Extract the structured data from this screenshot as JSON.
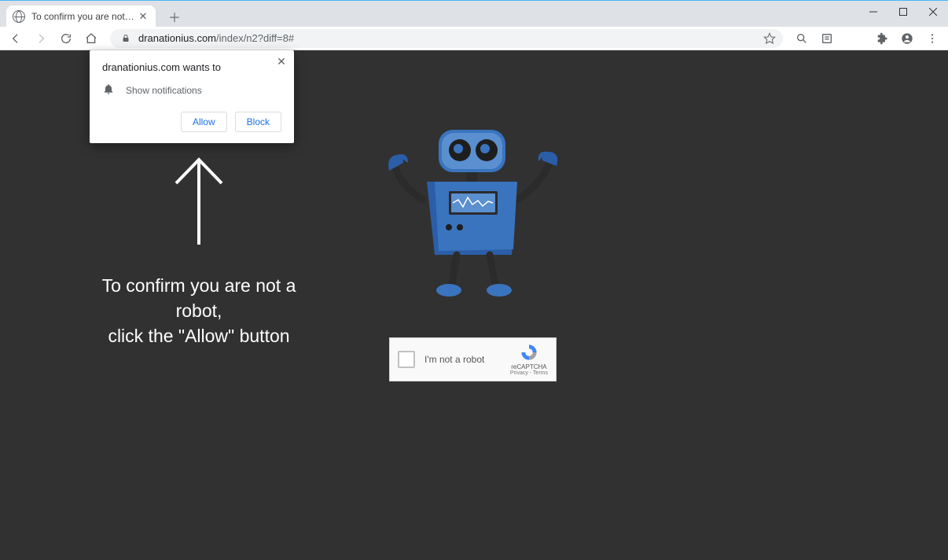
{
  "window": {
    "minimize": "–",
    "maximize": "☐",
    "close": "✕"
  },
  "tab": {
    "title": "To confirm you are not a robot, c"
  },
  "toolbar": {
    "url_domain": "dranationius.com",
    "url_path": "/index/n2?diff=8#"
  },
  "permission": {
    "title": "dranationius.com wants to",
    "request": "Show notifications",
    "allow": "Allow",
    "block": "Block"
  },
  "page": {
    "msg_line1": "To confirm you are not a robot,",
    "msg_line2": "click the \"Allow\" button"
  },
  "recaptcha": {
    "label": "I'm not a robot",
    "badge_title": "reCAPTCHA",
    "badge_terms": "Privacy - Terms"
  }
}
